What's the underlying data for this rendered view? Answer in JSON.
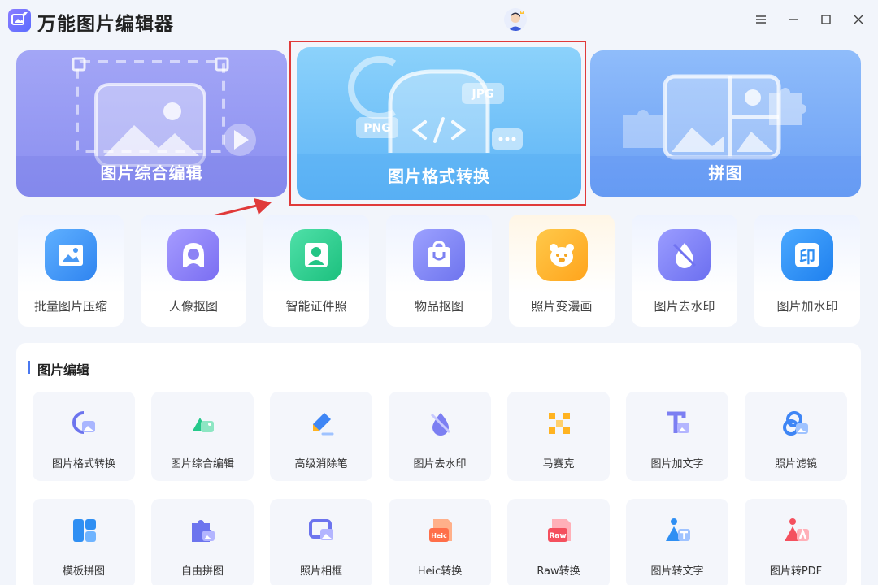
{
  "app": {
    "title": "万能图片编辑器"
  },
  "features": [
    {
      "label": "图片综合编辑"
    },
    {
      "label": "图片格式转换",
      "badge_png": "PNG",
      "badge_jpg": "JPG"
    },
    {
      "label": "拼图"
    }
  ],
  "tools": [
    {
      "label": "批量图片压缩",
      "icon": "image-compress-icon",
      "color": "#3b8ff5"
    },
    {
      "label": "人像抠图",
      "icon": "portrait-icon",
      "color": "#8a7cf7"
    },
    {
      "label": "智能证件照",
      "icon": "id-photo-icon",
      "color": "#2fcf8e"
    },
    {
      "label": "物品抠图",
      "icon": "bag-icon",
      "color": "#7f86f2"
    },
    {
      "label": "照片变漫画",
      "icon": "bear-icon",
      "color": "#ffb321"
    },
    {
      "label": "图片去水印",
      "icon": "watermark-remove-icon",
      "color": "#7d7ff0"
    },
    {
      "label": "图片加水印",
      "icon": "stamp-icon",
      "color": "#2f8ff3"
    }
  ],
  "section": {
    "title": "图片编辑",
    "items": [
      {
        "label": "图片格式转换",
        "icon": "format-convert-icon"
      },
      {
        "label": "图片综合编辑",
        "icon": "comprehensive-edit-icon"
      },
      {
        "label": "高级消除笔",
        "icon": "eraser-pen-icon"
      },
      {
        "label": "图片去水印",
        "icon": "watermark-remove-icon"
      },
      {
        "label": "马赛克",
        "icon": "mosaic-icon"
      },
      {
        "label": "图片加文字",
        "icon": "add-text-icon"
      },
      {
        "label": "照片滤镜",
        "icon": "filter-icon"
      },
      {
        "label": "模板拼图",
        "icon": "template-collage-icon"
      },
      {
        "label": "自由拼图",
        "icon": "free-collage-icon"
      },
      {
        "label": "照片相框",
        "icon": "photo-frame-icon"
      },
      {
        "label": "Heic转换",
        "icon": "heic-icon",
        "tag": "Heic"
      },
      {
        "label": "Raw转换",
        "icon": "raw-icon",
        "tag": "Raw"
      },
      {
        "label": "图片转文字",
        "icon": "image-to-text-icon"
      },
      {
        "label": "图片转PDF",
        "icon": "image-to-pdf-icon"
      }
    ]
  }
}
